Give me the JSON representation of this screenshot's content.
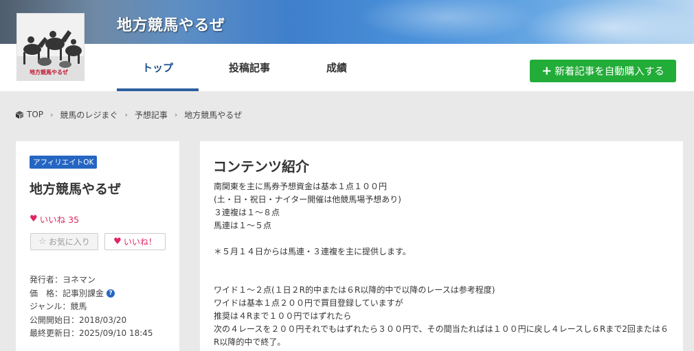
{
  "header": {
    "site_title": "地方競馬やるぜ",
    "logo_caption": "地方競馬やるぜ",
    "tabs": [
      {
        "label": "トップ",
        "active": true
      },
      {
        "label": "投稿記事",
        "active": false
      },
      {
        "label": "成績",
        "active": false
      }
    ],
    "buy_button": {
      "icon": "plus-icon",
      "label": "新着記事を自動購入する",
      "color": "#22ac38"
    }
  },
  "breadcrumb": {
    "icon": "cube-icon",
    "items": [
      "TOP",
      "競馬のレジまぐ",
      "予想記事",
      "地方競馬やるぜ"
    ]
  },
  "sidebar": {
    "badge": "アフィリエイトOK",
    "title": "地方競馬やるぜ",
    "likes_label": "いいね 35",
    "favorite_button": "お気に入り",
    "like_button": "いいね！",
    "meta": [
      "発行者：ヨネマン",
      "価　格：記事別課金",
      "ジャンル：競馬",
      "公開開始日：2018/03/20",
      "最終更新日：2025/09/10 18:45"
    ]
  },
  "main": {
    "heading": "コンテンツ紹介",
    "lines": [
      "南関東を主に馬券予想資金は基本１点１００円",
      "(土・日・祝日・ナイター開催は他競馬場予想あり)",
      "３連複は１～８点",
      "馬連は１～５点",
      "",
      "＊５月１４日からは馬連・３連複を主に提供します。",
      "",
      "",
      "ワイド１～２点(１日２R的中または６R以降的中で以降のレースは参考程度)",
      "ワイドは基本１点２００円で買目登録していますが",
      "推奨は４Rまで１００円ではずれたら",
      "次の４レースを２００円それでもはずれたら３００円で、その間当たればは１００円に戻し４レースし６Rまで2回または６",
      "R以降的中で終了。"
    ]
  },
  "colors": {
    "accent": "#2b5e9e",
    "badge": "#2566c2",
    "like": "#e0245e",
    "background": "#e9e9e9"
  }
}
